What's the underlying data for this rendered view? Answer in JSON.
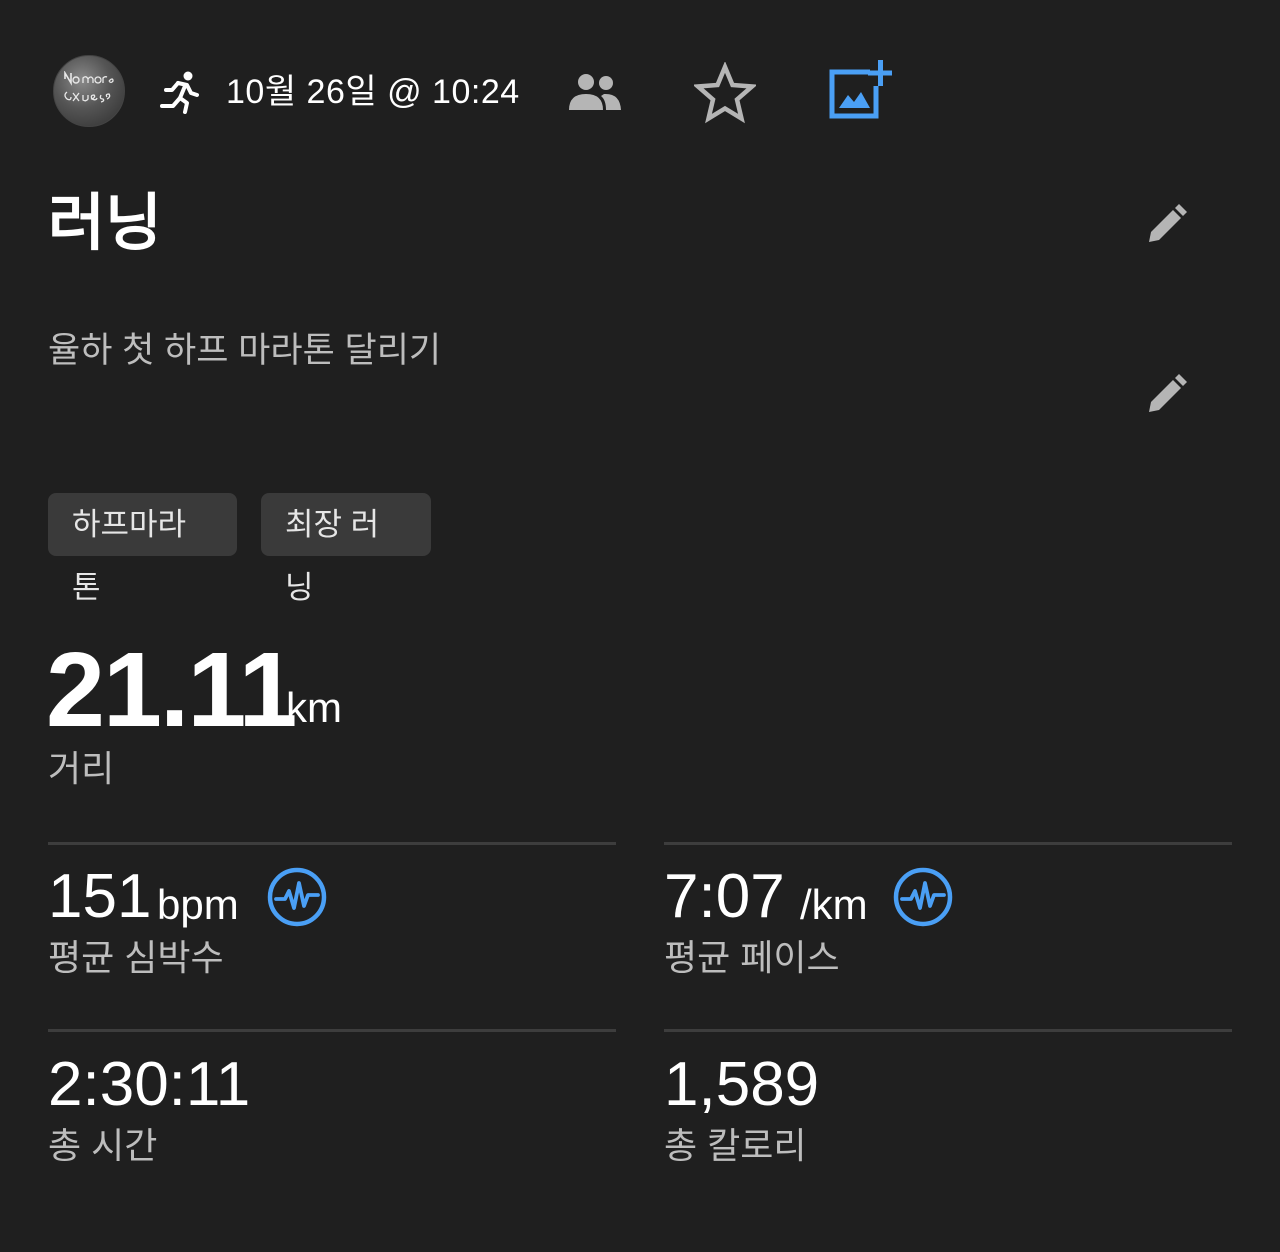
{
  "header": {
    "datetime": "10월 26일 @ 10:24",
    "avatar_text_line1": "No more",
    "avatar_text_line2": "excuses"
  },
  "activity": {
    "title": "러닝",
    "description": "율하 첫 하프 마라톤 달리기",
    "tags": [
      "하프마라톤",
      "최장 러닝"
    ]
  },
  "distance": {
    "value": "21.11",
    "unit": "km",
    "label": "거리"
  },
  "stats": {
    "heart_rate": {
      "value": "151",
      "unit": "bpm",
      "label": "평균 심박수"
    },
    "pace": {
      "value": "7:07",
      "unit": "/km",
      "label": "평균 페이스"
    },
    "time": {
      "value": "2:30:11",
      "label": "총 시간"
    },
    "calories": {
      "value": "1,589",
      "label": "총 칼로리"
    }
  },
  "colors": {
    "background": "#1f1f1f",
    "accent_blue": "#4a9ff5",
    "tag_bg": "#3a3a3a",
    "icon_gray": "#b5b5b5"
  },
  "icons": [
    "avatar",
    "running-icon",
    "people-icon",
    "star-icon",
    "add-photo-icon",
    "edit-icon",
    "heart-rate-chart-icon"
  ]
}
